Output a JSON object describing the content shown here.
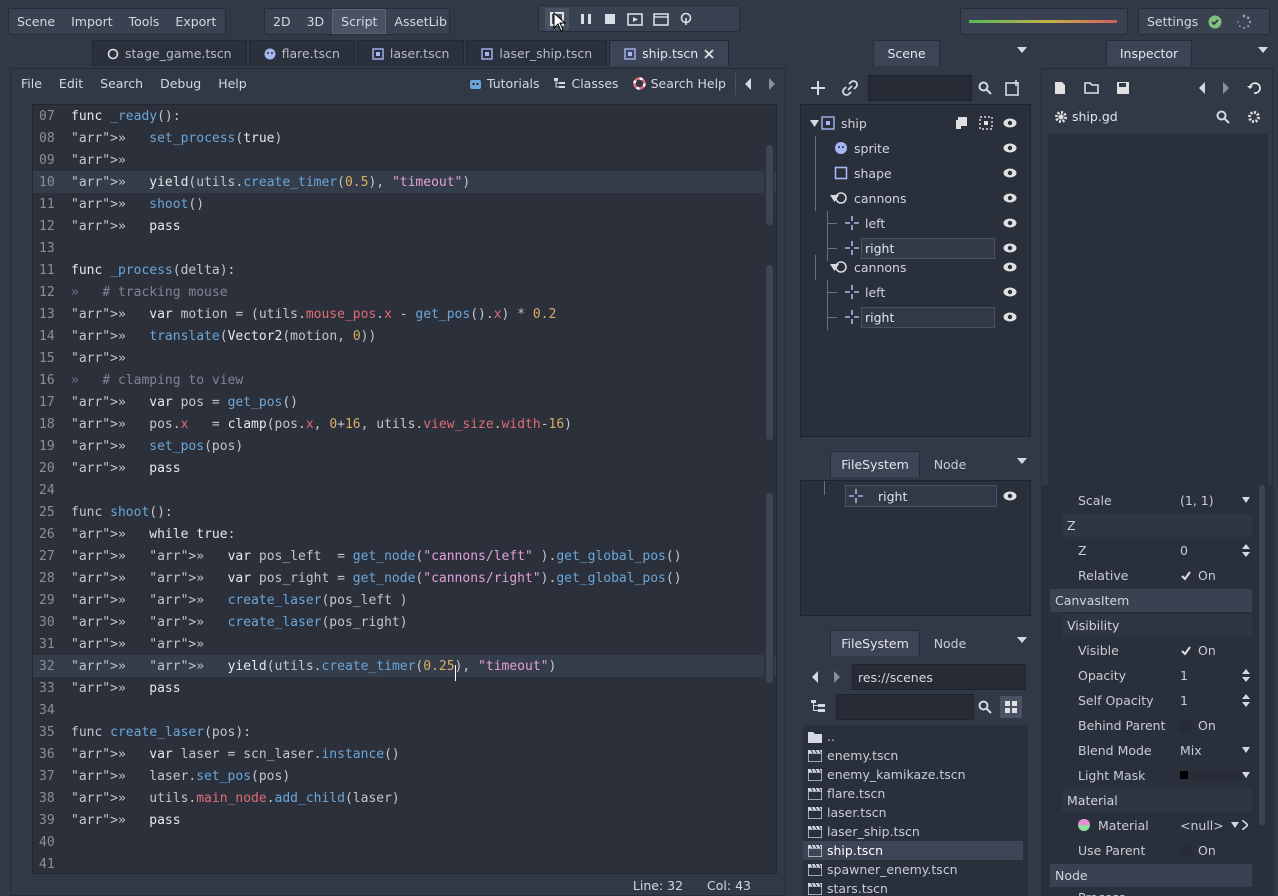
{
  "menu": {
    "scene": "Scene",
    "import": "Import",
    "tools": "Tools",
    "export": "Export"
  },
  "modes": {
    "m2d": "2D",
    "m3d": "3D",
    "script": "Script",
    "assetlib": "AssetLib"
  },
  "settings": "Settings",
  "tabs": [
    {
      "label": "stage_game.tscn",
      "icon": "circle-node-icon"
    },
    {
      "label": "flare.tscn",
      "icon": "sprite-icon"
    },
    {
      "label": "laser.tscn",
      "icon": "node2d-icon"
    },
    {
      "label": "laser_ship.tscn",
      "icon": "node2d-icon"
    },
    {
      "label": "ship.tscn",
      "icon": "node2d-icon"
    }
  ],
  "editor_menu": {
    "file": "File",
    "edit": "Edit",
    "search": "Search",
    "debug": "Debug",
    "help": "Help",
    "tutorials": "Tutorials",
    "classes": "Classes",
    "search_help": "Search Help"
  },
  "status": {
    "line": "Line: 32",
    "col": "Col: 43"
  },
  "scene_panel": {
    "tab": "Scene",
    "nodes": [
      {
        "name": "ship",
        "indent": 0
      },
      {
        "name": "sprite",
        "indent": 1
      },
      {
        "name": "shape",
        "indent": 1
      },
      {
        "name": "cannons",
        "indent": 1
      },
      {
        "name": "left",
        "indent": 2
      },
      {
        "name": "right",
        "indent": 2
      },
      {
        "name": "cannons",
        "indent": 1
      },
      {
        "name": "left",
        "indent": 2
      },
      {
        "name": "right",
        "indent": 2
      }
    ]
  },
  "dock_tabs": {
    "filesystem": "FileSystem",
    "node": "Node"
  },
  "drag_item": "right",
  "filesystem": {
    "path": "res://scenes",
    "files": [
      "..",
      "enemy.tscn",
      "enemy_kamikaze.tscn",
      "flare.tscn",
      "laser.tscn",
      "laser_ship.tscn",
      "ship.tscn",
      "spawner_enemy.tscn",
      "stars.tscn"
    ],
    "selected": "ship.tscn"
  },
  "inspector": {
    "tab": "Inspector",
    "file": "ship.gd",
    "rows": [
      {
        "key": "Scale",
        "val": "(1, 1)"
      },
      {
        "key": "Z",
        "val": ""
      },
      {
        "key": "Z",
        "val": "0"
      },
      {
        "key": "Relative",
        "val": "On"
      },
      {
        "key": "CanvasItem",
        "val": ""
      },
      {
        "key": "Visibility",
        "val": ""
      },
      {
        "key": "Visible",
        "val": "On"
      },
      {
        "key": "Opacity",
        "val": "1"
      },
      {
        "key": "Self Opacity",
        "val": "1"
      },
      {
        "key": "Behind Parent",
        "val": "On"
      },
      {
        "key": "Blend Mode",
        "val": "Mix"
      },
      {
        "key": "Light Mask",
        "val": ""
      },
      {
        "key": "Material",
        "val": ""
      },
      {
        "key": "Material",
        "val": "<null>"
      },
      {
        "key": "Use Parent",
        "val": "On"
      },
      {
        "key": "Node",
        "val": ""
      },
      {
        "key": "Process",
        "val": ""
      }
    ]
  },
  "code": [
    {
      "n": "07",
      "t": "func _ready():"
    },
    {
      "n": "08",
      "t": "»   set_process(true)"
    },
    {
      "n": "09",
      "t": "»"
    },
    {
      "n": "10",
      "t": "»   yield(utils.create_timer(0.5), \"timeout\")",
      "hl": true
    },
    {
      "n": "11",
      "t": "»   shoot()"
    },
    {
      "n": "12",
      "t": "»   pass"
    },
    {
      "n": "13",
      "t": ""
    },
    {
      "n": "11",
      "t": "func _process(delta):"
    },
    {
      "n": "12",
      "t": "»   # tracking mouse"
    },
    {
      "n": "13",
      "t": "»   var motion = (utils.mouse_pos.x - get_pos().x) * 0.2"
    },
    {
      "n": "14",
      "t": "»   translate(Vector2(motion, 0))"
    },
    {
      "n": "15",
      "t": "»"
    },
    {
      "n": "16",
      "t": "»   # clamping to view"
    },
    {
      "n": "17",
      "t": "»   var pos = get_pos()"
    },
    {
      "n": "18",
      "t": "»   pos.x   = clamp(pos.x, 0+16, utils.view_size.width-16)"
    },
    {
      "n": "19",
      "t": "»   set_pos(pos)"
    },
    {
      "n": "20",
      "t": "»   pass"
    },
    {
      "n": "24",
      "t": ""
    },
    {
      "n": "25",
      "t": "func shoot():"
    },
    {
      "n": "26",
      "t": "»   while true:"
    },
    {
      "n": "27",
      "t": "»   »   var pos_left  = get_node(\"cannons/left\" ).get_global_pos()"
    },
    {
      "n": "28",
      "t": "»   »   var pos_right = get_node(\"cannons/right\").get_global_pos()"
    },
    {
      "n": "29",
      "t": "»   »   create_laser(pos_left )"
    },
    {
      "n": "30",
      "t": "»   »   create_laser(pos_right)"
    },
    {
      "n": "31",
      "t": "»   »"
    },
    {
      "n": "32",
      "t": "»   »   yield(utils.create_timer(0.25), \"timeout\")",
      "hl": true
    },
    {
      "n": "33",
      "t": "»   pass"
    },
    {
      "n": "34",
      "t": ""
    },
    {
      "n": "35",
      "t": "func create_laser(pos):"
    },
    {
      "n": "36",
      "t": "»   var laser = scn_laser.instance()"
    },
    {
      "n": "37",
      "t": "»   laser.set_pos(pos)"
    },
    {
      "n": "38",
      "t": "»   utils.main_node.add_child(laser)"
    },
    {
      "n": "39",
      "t": "»   pass"
    },
    {
      "n": "40",
      "t": ""
    },
    {
      "n": "41",
      "t": ""
    }
  ],
  "colors": {
    "bg": "#313846",
    "panel": "#2a303b",
    "accent": "#6aa6d8",
    "string": "#e2a0d8",
    "number": "#d8b060",
    "member": "#e06c75"
  }
}
